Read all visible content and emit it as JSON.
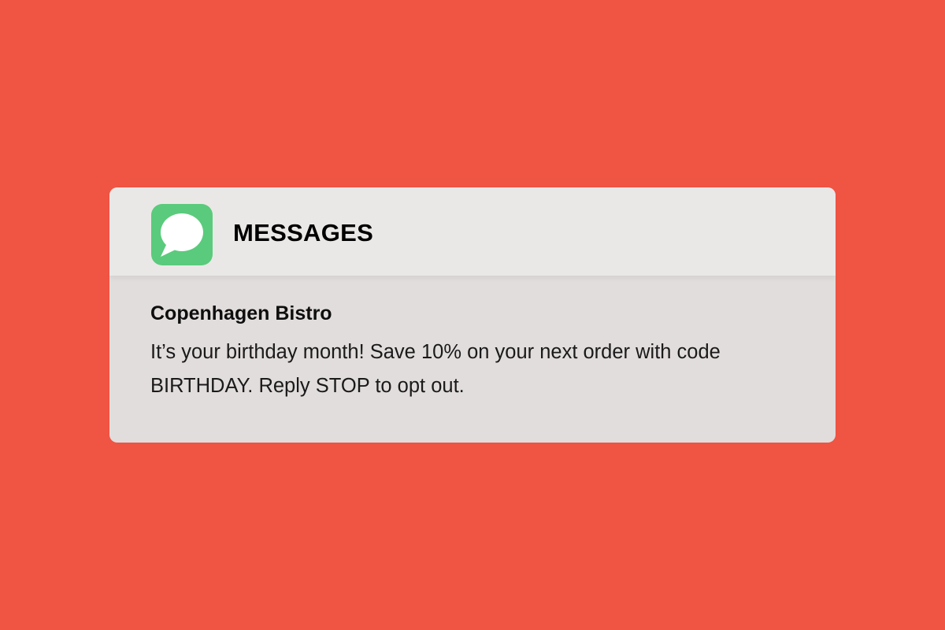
{
  "background_color": "#F05443",
  "notification": {
    "app": {
      "icon": "messages-speech-bubble-icon",
      "icon_color": "#5ACB7C",
      "name": "MESSAGES"
    },
    "sender": "Copenhagen Bistro",
    "message": "It’s your birthday month! Save 10% on your next order with code BIRTHDAY. Reply STOP to opt out."
  }
}
